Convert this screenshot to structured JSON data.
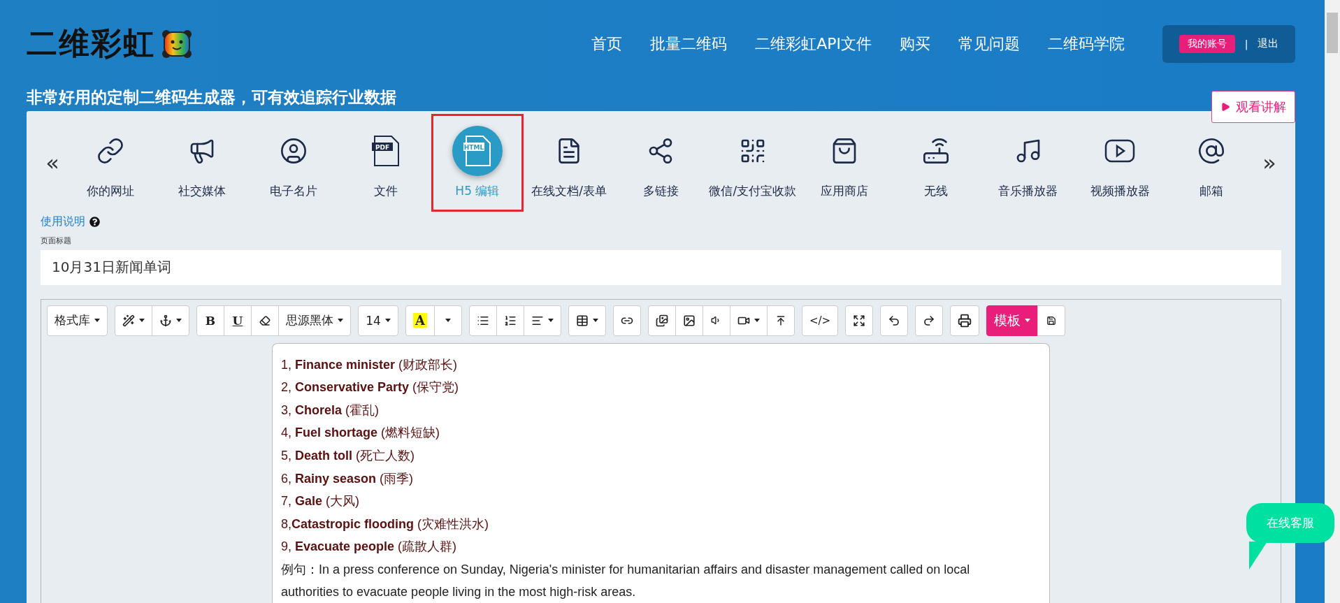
{
  "header": {
    "logo": "二维彩虹",
    "nav": [
      {
        "label": "首页"
      },
      {
        "label": "批量二维码"
      },
      {
        "label": "二维彩虹API文件"
      },
      {
        "label": "购买"
      },
      {
        "label": "常见问题"
      },
      {
        "label": "二维码学院"
      }
    ],
    "account": {
      "button": "我的账号",
      "separator": "|",
      "logout": "退出"
    }
  },
  "tagline": "非常好用的定制二维码生成器，可有效追踪行业数据",
  "tutorial_button": "观看讲解",
  "categories": {
    "prev": "«",
    "next": "»",
    "items": [
      {
        "label": "你的网址",
        "selected": false
      },
      {
        "label": "社交媒体",
        "selected": false
      },
      {
        "label": "电子名片",
        "selected": false
      },
      {
        "label": "文件",
        "selected": false,
        "icon_text": "PDF"
      },
      {
        "label": "H5 编辑",
        "selected": true,
        "icon_text": "HTML"
      },
      {
        "label": "在线文档/表单",
        "selected": false
      },
      {
        "label": "多链接",
        "selected": false
      },
      {
        "label": "微信/支付宝收款",
        "selected": false
      },
      {
        "label": "应用商店",
        "selected": false
      },
      {
        "label": "无线",
        "selected": false
      },
      {
        "label": "音乐播放器",
        "selected": false
      },
      {
        "label": "视频播放器",
        "selected": false
      },
      {
        "label": "邮箱",
        "selected": false
      }
    ]
  },
  "help_link": "使用说明",
  "page_title": {
    "label": "页面标题",
    "value": "10月31日新闻单词"
  },
  "toolbar": {
    "style_menu": "格式库",
    "bold": "B",
    "underline": "U",
    "font_menu": "思源黑体",
    "size_menu": "14",
    "font_color": "A",
    "code": "</>",
    "template_menu": "模板"
  },
  "editor": {
    "lines": [
      "1, **Finance minister** (财政部长)",
      "2, **Conservative Party** (保守党)",
      "3, **Chorela** (霍乱)",
      "4, **Fuel shortage** (燃料短缺)",
      "5, **Death toll** (死亡人数)",
      "6, **Rainy season** (雨季)",
      "7, **Gale** (大风)",
      "8,**Catastropic flooding** (灾难性洪水)",
      "9, **Evacuate people** (疏散人群)"
    ],
    "example": "例句：In a press conference on Sunday, Nigeria's minister for humanitarian affairs and disaster management called on local authorities to evacuate people living in the most high-risk areas."
  },
  "chat_button": "在线客服"
}
